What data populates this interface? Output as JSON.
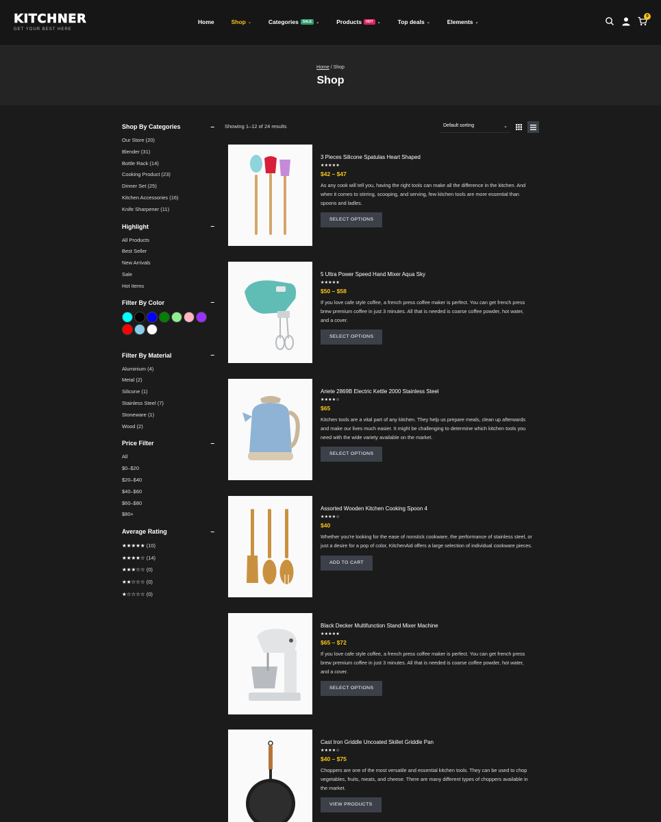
{
  "brand": {
    "name": "KITCHNER",
    "tagline": "GET YOUR BEST HERE"
  },
  "nav": [
    {
      "label": "Home",
      "active": false,
      "has_caret": false
    },
    {
      "label": "Shop",
      "active": true,
      "has_caret": true
    },
    {
      "label": "Categories",
      "badge": "SALE",
      "active": false,
      "has_caret": true
    },
    {
      "label": "Products",
      "badge": "HOT",
      "active": false,
      "has_caret": true
    },
    {
      "label": "Top deals",
      "active": false,
      "has_caret": true
    },
    {
      "label": "Elements",
      "active": false,
      "has_caret": true
    }
  ],
  "header_icons": {
    "search": "search-icon",
    "account": "user-icon",
    "cart": "cart-icon",
    "cart_count": "0"
  },
  "breadcrumb": {
    "home": "Home",
    "separator": "/",
    "current": "Shop"
  },
  "page_title": "Shop",
  "sidebar": {
    "categories": {
      "title": "Shop By Categories",
      "items": [
        "Our Store (20)",
        "Blender (31)",
        "Bottle Rack (14)",
        "Cooking Product (23)",
        "Dinner Set (25)",
        "Kitchen Accessories (16)",
        "Knife Sharpener (11)"
      ]
    },
    "highlight": {
      "title": "Highlight",
      "items": [
        "All Products",
        "Best Seller",
        "New Arrivals",
        "Sale",
        "Hot Items"
      ]
    },
    "color": {
      "title": "Filter By Color",
      "swatches": [
        "#00ffff",
        "#000000",
        "#0000ff",
        "#008000",
        "#90ee90",
        "#ffb6c1",
        "#9b30ff",
        "#ff0000",
        "#87ceeb",
        "#ffffff"
      ]
    },
    "material": {
      "title": "Filter By Material",
      "items": [
        "Aluminium (4)",
        "Metal (2)",
        "Silicone (1)",
        "Stainless Steel (7)",
        "Stoneware (1)",
        "Wood (2)"
      ]
    },
    "price": {
      "title": "Price Filter",
      "items": [
        "All",
        "$0–$20",
        "$20–$40",
        "$40–$60",
        "$60–$80",
        "$80+"
      ]
    },
    "rating": {
      "title": "Average Rating",
      "items": [
        {
          "stars": "★★★★★",
          "count": "(10)"
        },
        {
          "stars": "★★★★☆",
          "count": "(14)"
        },
        {
          "stars": "★★★☆☆",
          "count": "(0)"
        },
        {
          "stars": "★★☆☆☆",
          "count": "(0)"
        },
        {
          "stars": "★☆☆☆☆",
          "count": "(0)"
        }
      ]
    },
    "collapse_symbol": "–"
  },
  "toolbar": {
    "result_count": "Showing 1–12 of 24 results",
    "sort": "Default sorting"
  },
  "products": [
    {
      "name": "3 Pieces Silicone Spatulas Heart Shaped",
      "stars": "★★★★★",
      "price": "$42 – $47",
      "desc": "As any cook will tell you, having the right tools can make all the difference in the kitchen. And when it comes to stirring, scooping, and serving, few kitchen tools are more essential than spoons and ladles.",
      "button": "SELECT OPTIONS",
      "image": "spatulas"
    },
    {
      "name": "5 Ultra Power Speed Hand Mixer Aqua Sky",
      "stars": "★★★★★",
      "price": "$50 – $58",
      "desc": "If you love cafe style coffee, a french press coffee maker is perfect. You can get french press brew premium coffee in just 3 minutes. All that is needed is coarse coffee powder, hot water, and a cover.",
      "button": "SELECT OPTIONS",
      "image": "hand-mixer"
    },
    {
      "name": "Ariete 2869B Electric Kettle 2000 Stainless Steel",
      "stars": "★★★★☆",
      "price": "$65",
      "desc": "Kitchen tools are a vital part of any kitchen. They help us prepare meals, clean up afterwards and make our lives much easier. It might be challenging to determine which kitchen tools you need with the wide variety available on the market.",
      "button": "SELECT OPTIONS",
      "image": "kettle"
    },
    {
      "name": "Assorted Wooden Kitchen Cooking Spoon 4",
      "stars": "★★★★☆",
      "price": "$40",
      "desc": "Whether you're looking for the ease of nonstick cookware, the performance of stainless steel, or just a desire for a pop of color, KitchenAid offers a large selection of individual cookware pieces.",
      "button": "ADD TO CART",
      "image": "wooden-spoons"
    },
    {
      "name": "Black Decker Multifunction Stand Mixer Machine",
      "stars": "★★★★★",
      "price": "$65 – $72",
      "desc": "If you love cafe style coffee, a french press coffee maker is perfect. You can get french press brew premium coffee in just 3 minutes. All that is needed is coarse coffee powder, hot water, and a cover.",
      "button": "SELECT OPTIONS",
      "image": "stand-mixer"
    },
    {
      "name": "Cast Iron Griddle Uncoated Skillet Griddle Pan",
      "stars": "★★★★☆",
      "price": "$40 – $75",
      "desc": "Choppers are one of the most versatile and essential kitchen tools. They can be used to chop vegetables, fruits, meats, and cheese. There are many different types of choppers available in the market.",
      "button": "VIEW PRODUCTS",
      "image": "griddle-pan"
    }
  ]
}
